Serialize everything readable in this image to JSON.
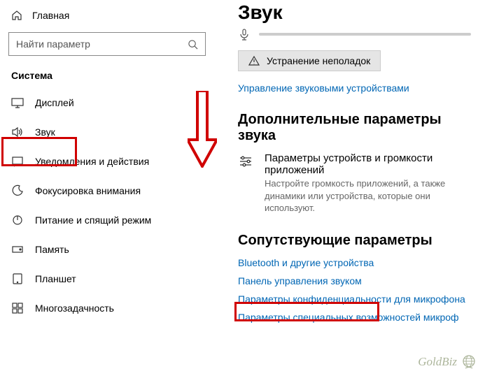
{
  "sidebar": {
    "home": "Главная",
    "search_placeholder": "Найти параметр",
    "category": "Система",
    "items": [
      {
        "label": "Дисплей"
      },
      {
        "label": "Звук"
      },
      {
        "label": "Уведомления и действия"
      },
      {
        "label": "Фокусировка внимания"
      },
      {
        "label": "Питание и спящий режим"
      },
      {
        "label": "Память"
      },
      {
        "label": "Планшет"
      },
      {
        "label": "Многозадачность"
      }
    ]
  },
  "main": {
    "title": "Звук",
    "troubleshoot": "Устранение неполадок",
    "manage_devices": "Управление звуковыми устройствами",
    "advanced_title": "Дополнительные параметры звука",
    "app_volume_title": "Параметры устройств и громкости приложений",
    "app_volume_desc": "Настройте громкость приложений, а также динамики или устройства, которые они используют.",
    "related_title": "Сопутствующие параметры",
    "related_links": [
      "Bluetooth и другие устройства",
      "Панель управления звуком",
      "Параметры конфиденциальности для микрофона",
      "Параметры специальных возможностей микроф"
    ]
  },
  "watermark": "GoldBiz"
}
